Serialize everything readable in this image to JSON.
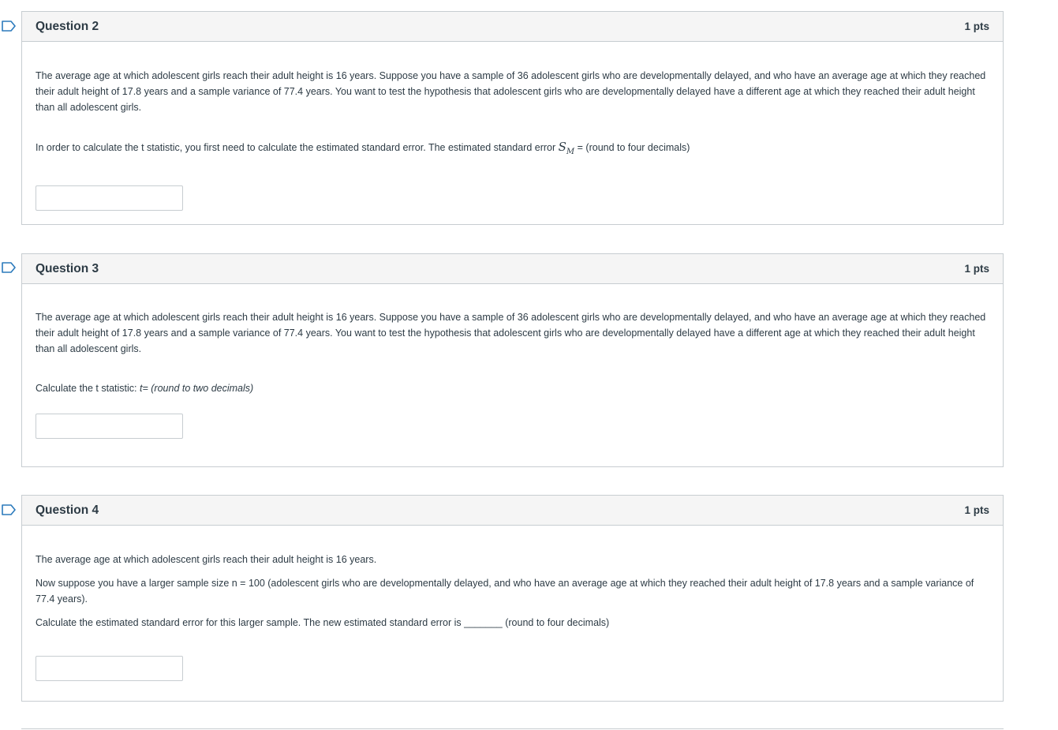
{
  "questions": [
    {
      "title": "Question 2",
      "points": "1 pts",
      "scenario": "The average age at which adolescent girls reach their adult height is 16 years. Suppose you have a sample of 36 adolescent girls who are developmentally delayed, and who have an average age at which they reached their adult height of 17.8 years and a sample variance of 77.4 years. You want to test the hypothesis that adolescent girls who are developmentally delayed have a different age at which they reached their adult height than all adolescent girls.",
      "prompt_before": "In order to calculate the t statistic, you first need to calculate the estimated standard error. The estimated standard error",
      "math_symbol": "S",
      "math_sub": "M",
      "prompt_after": "= (round to four decimals)",
      "answer": ""
    },
    {
      "title": "Question 3",
      "points": "1 pts",
      "scenario": "The average age at which adolescent girls reach their adult height is 16 years. Suppose you have a sample of 36 adolescent girls who are developmentally delayed, and who have an average age at which they reached their adult height of 17.8 years and a sample variance of 77.4 years. You want to test the hypothesis that adolescent girls who are developmentally delayed have a different age at which they reached their adult height than all adolescent girls.",
      "prompt_plain": "Calculate the t statistic: ",
      "prompt_italic": "t= (round to two decimals)",
      "answer": ""
    },
    {
      "title": "Question 4",
      "points": "1 pts",
      "line1": "The average age at which adolescent girls reach their adult height is 16 years.",
      "line2": "Now suppose you have a larger sample size n = 100 (adolescent girls who are developmentally delayed, and who have an average age at which they reached their adult height of 17.8 years and a sample variance of 77.4 years).",
      "line3": "Calculate the estimated standard error for this larger sample. The new estimated standard error is _______ (round to four decimals)",
      "answer": ""
    }
  ],
  "colors": {
    "flag": "#2b7abc",
    "border": "#c7cdd1",
    "header_bg": "#f5f5f5",
    "text": "#2d3b45"
  },
  "icons": {
    "flag": "bookmark-flag-icon"
  }
}
